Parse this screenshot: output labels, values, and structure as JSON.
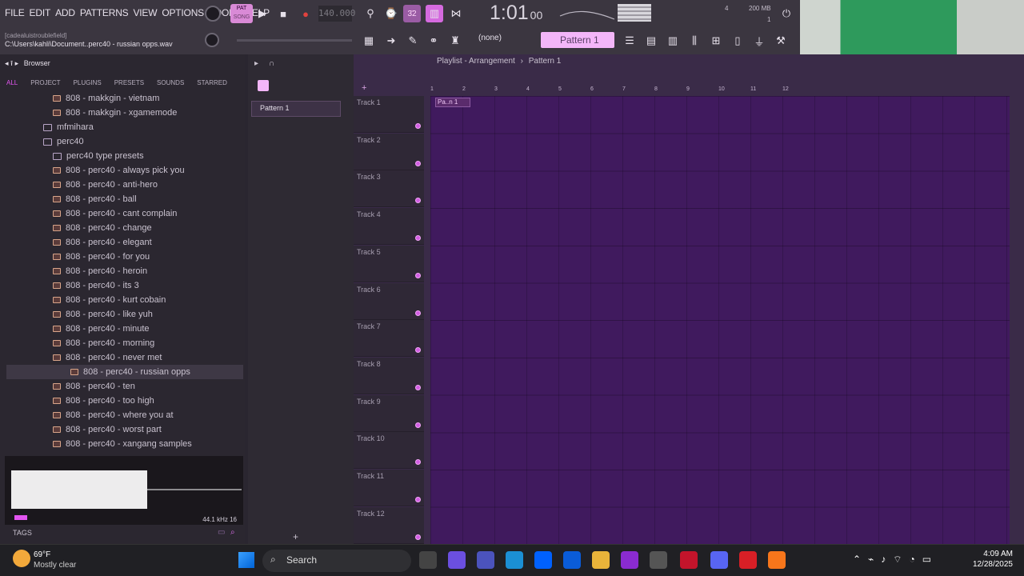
{
  "menu": [
    "FILE",
    "EDIT",
    "ADD",
    "PATTERNS",
    "VIEW",
    "OPTIONS",
    "TOOLS",
    "HELP"
  ],
  "transport": {
    "pat_label": "PAT",
    "song_label": "SONG",
    "tempo": "140.000",
    "time": "1:01",
    "time_sub": "00",
    "cpu_mem": "200 MB",
    "cpu_num": "4",
    "poly": "1"
  },
  "hint": {
    "line1": "[cadealuistroublefield]",
    "line2": "C:\\Users\\kahli\\Document..perc40 - russian opps.wav"
  },
  "pattern": {
    "none_label": "(none)",
    "name": "Pattern 1"
  },
  "browser": {
    "title": "Browser",
    "tabs": [
      "ALL",
      "PROJECT",
      "PLUGINS",
      "PRESETS",
      "SOUNDS",
      "STARRED"
    ],
    "items": [
      {
        "label": "808 - makkgin - vietnam",
        "kind": "file"
      },
      {
        "label": "808 - makkgin - xgamemode",
        "kind": "file"
      },
      {
        "label": "mfmihara",
        "kind": "folder"
      },
      {
        "label": "perc40",
        "kind": "folder"
      },
      {
        "label": "perc40 type presets",
        "kind": "folder"
      },
      {
        "label": "808 - perc40 - always pick you",
        "kind": "file"
      },
      {
        "label": "808 - perc40 - anti-hero",
        "kind": "file"
      },
      {
        "label": "808 - perc40 - ball",
        "kind": "file"
      },
      {
        "label": "808 - perc40 - cant complain",
        "kind": "file"
      },
      {
        "label": "808 - perc40 - change",
        "kind": "file"
      },
      {
        "label": "808 - perc40 - elegant",
        "kind": "file"
      },
      {
        "label": "808 - perc40 - for you",
        "kind": "file"
      },
      {
        "label": "808 - perc40 - heroin",
        "kind": "file"
      },
      {
        "label": "808 - perc40 - its 3",
        "kind": "file"
      },
      {
        "label": "808 - perc40 - kurt cobain",
        "kind": "file"
      },
      {
        "label": "808 - perc40 - like yuh",
        "kind": "file"
      },
      {
        "label": "808 - perc40 - minute",
        "kind": "file"
      },
      {
        "label": "808 - perc40 - morning",
        "kind": "file"
      },
      {
        "label": "808 - perc40 - never met",
        "kind": "file"
      },
      {
        "label": "808 - perc40 - russian opps",
        "kind": "file"
      },
      {
        "label": "808 - perc40 - ten",
        "kind": "file"
      },
      {
        "label": "808 - perc40 - too high",
        "kind": "file"
      },
      {
        "label": "808 - perc40 - where you at",
        "kind": "file"
      },
      {
        "label": "808 - perc40 - worst part",
        "kind": "file"
      },
      {
        "label": "808 - perc40 - xangang samples",
        "kind": "file"
      }
    ],
    "selected_index": 19,
    "sample_info": "44.1 kHz 16",
    "tags_label": "TAGS"
  },
  "playlist": {
    "title": "Playlist - Arrangement",
    "crumb": "Pattern 1",
    "pattern_list": [
      "Pattern 1"
    ],
    "ruler": [
      "1",
      "2",
      "3",
      "4",
      "5",
      "6",
      "7",
      "8",
      "9",
      "10",
      "11",
      "12"
    ],
    "clip_label": "Pa..n 1",
    "tracks": [
      "Track 1",
      "Track 2",
      "Track 3",
      "Track 4",
      "Track 5",
      "Track 6",
      "Track 7",
      "Track 8",
      "Track 9",
      "Track 10",
      "Track 11",
      "Track 12"
    ]
  },
  "taskbar": {
    "weather_temp": "69°F",
    "weather_desc": "Mostly clear",
    "search": "Search",
    "time": "4:09 AM",
    "date": "12/28/2025"
  },
  "colors": {
    "accent": "#e255f0",
    "playlist_bg": "#401a5e",
    "pattern_pink": "#f3b6f9"
  }
}
